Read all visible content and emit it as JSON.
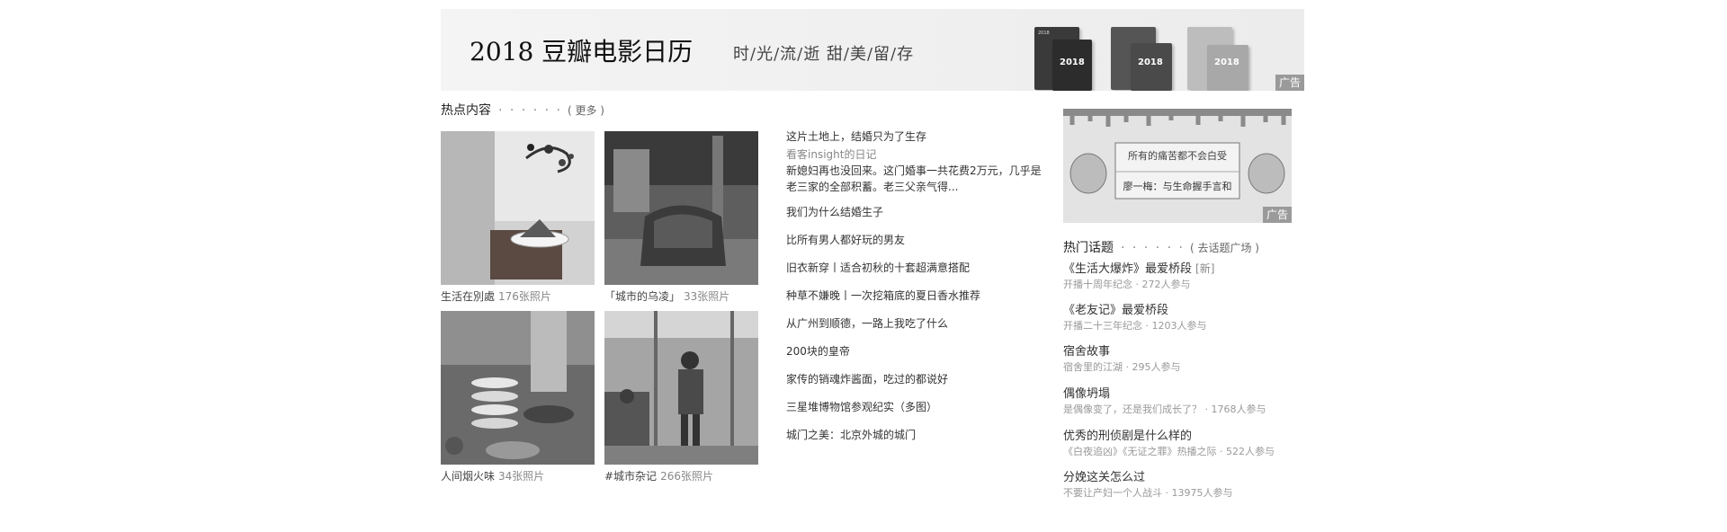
{
  "banner": {
    "title": "2018  豆瓣电影日历",
    "slogan": "时/光/流/逝   甜/美/留/存",
    "book_year": "2018",
    "ad_label": "广告"
  },
  "hot": {
    "title": "热点内容",
    "dots": "· · · · · ·",
    "more": "( 更多 )",
    "photos": [
      {
        "name": "生活在別處",
        "count": "176张照片"
      },
      {
        "name": "「城市的乌凌」",
        "count": "33张照片"
      },
      {
        "name": "人间烟火味",
        "count": "34张照片"
      },
      {
        "name": "#城市杂记",
        "count": "266张照片"
      }
    ],
    "feature": {
      "title": "这片土地上，结婚只为了生存",
      "author": "看客insight的日记",
      "desc": "新媳妇再也没回来。这门婚事一共花费2万元，几乎是老三家的全部积蓄。老三父亲气得..."
    },
    "articles": [
      "我们为什么结婚生子",
      "比所有男人都好玩的男友",
      "旧衣新穿丨适合初秋的十套超满意搭配",
      "种草不嫌晚丨一次挖箱底的夏日香水推荐",
      "从广州到顺德，一路上我吃了什么",
      "200块的皇帝",
      "家传的销魂炸酱面，吃过的都说好",
      "三星堆博物馆参观纪实（多图）",
      "城门之美：北京外城的城门"
    ]
  },
  "ad2": {
    "headline": "所有的痛苦都不会白受",
    "subline": "廖一梅：与生命握手言和",
    "ad_label": "广告"
  },
  "topics": {
    "title": "热门话题",
    "dots": "· · · · · ·",
    "more": "( 去话题广场 )",
    "items": [
      {
        "name": "《生活大爆炸》最爱桥段",
        "badge": "[新]",
        "sub": "开播十周年纪念 · 272人参与"
      },
      {
        "name": "《老友记》最爱桥段",
        "badge": "",
        "sub": "开播二十三年纪念 · 1203人参与"
      },
      {
        "name": "宿舍故事",
        "badge": "",
        "sub": "宿舍里的江湖 · 295人参与"
      },
      {
        "name": "偶像坍塌",
        "badge": "",
        "sub": "是偶像变了，还是我们成长了？ · 1768人参与"
      },
      {
        "name": "优秀的刑侦剧是什么样的",
        "badge": "",
        "sub": "《白夜追凶》《无证之罪》热播之际 · 522人参与"
      },
      {
        "name": "分娩这关怎么过",
        "badge": "",
        "sub": "不要让产妇一个人战斗 · 13975人参与"
      }
    ]
  }
}
